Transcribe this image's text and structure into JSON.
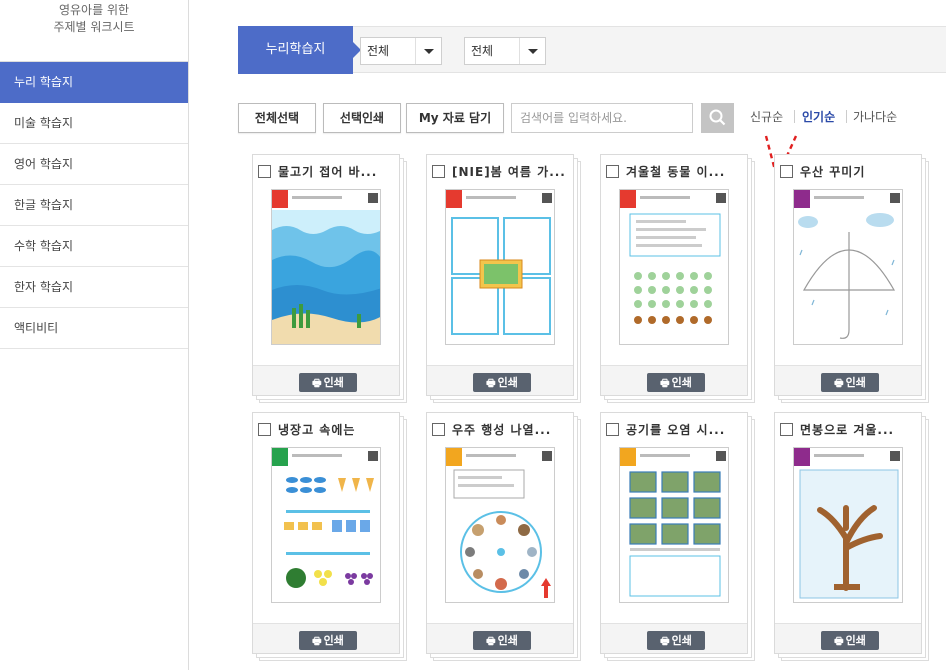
{
  "sidebar": {
    "head_line1": "영유아를 위한",
    "head_line2": "주제별 워크시트",
    "items": [
      {
        "label": "누리 학습지",
        "active": true
      },
      {
        "label": "미술 학습지"
      },
      {
        "label": "영어 학습지"
      },
      {
        "label": "한글 학습지"
      },
      {
        "label": "수학 학습지"
      },
      {
        "label": "한자 학습지"
      },
      {
        "label": "액티비티"
      }
    ]
  },
  "filter": {
    "category_tab": "누리학습지",
    "select1": "전체",
    "crumb_sep": ">",
    "select2": "전체"
  },
  "toolbar": {
    "select_all": "전체선택",
    "print_selected": "선택인쇄",
    "my_save": "My 자료 담기",
    "search_placeholder": "검색어를 입력하세요."
  },
  "sort": {
    "newest": "신규순",
    "popular": "인기순",
    "alpha": "가나다순"
  },
  "cards": [
    {
      "title": "물고기 접어 바..."
    },
    {
      "title": "[NIE]봄 여름 가..."
    },
    {
      "title": "겨울철 동물 이..."
    },
    {
      "title": "우산 꾸미기"
    },
    {
      "title": "냉장고 속에는"
    },
    {
      "title": "우주 행성 나열..."
    },
    {
      "title": "공기를 오염 시..."
    },
    {
      "title": "면봉으로 겨울..."
    }
  ],
  "print_label": "인쇄",
  "colors": {
    "accent": "#4d6cc8",
    "print_button": "#59626f",
    "sort_active": "#2b4aa8"
  }
}
